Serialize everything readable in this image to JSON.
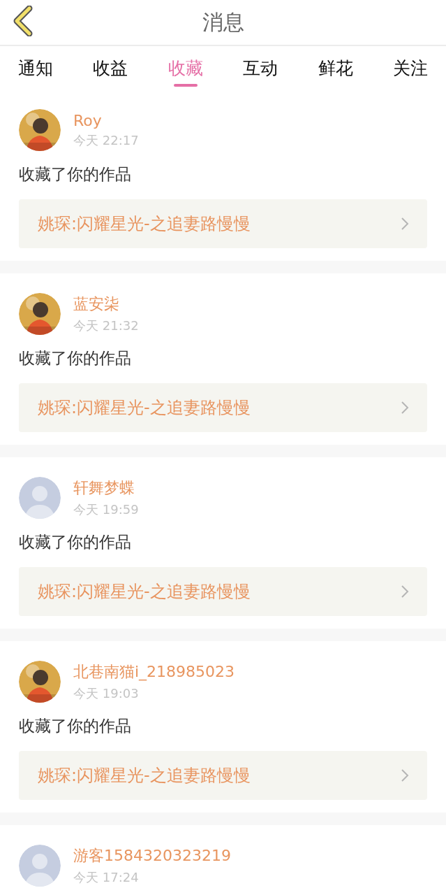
{
  "header": {
    "title": "消息"
  },
  "tabs": [
    {
      "label": "通知",
      "selected": false
    },
    {
      "label": "收益",
      "selected": false
    },
    {
      "label": "收藏",
      "selected": true
    },
    {
      "label": "互动",
      "selected": false
    },
    {
      "label": "鲜花",
      "selected": false
    },
    {
      "label": "关注",
      "selected": false
    }
  ],
  "messages": [
    {
      "name": "Roy",
      "time": "今天 22:17",
      "action": "收藏了你的作品",
      "work": "姚琛:闪耀星光-之追妻路慢慢"
    },
    {
      "name": "蓝安柒",
      "time": "今天 21:32",
      "action": "收藏了你的作品",
      "work": "姚琛:闪耀星光-之追妻路慢慢"
    },
    {
      "avatar": {
        "kind": "default"
      },
      "name": "轩舞梦蝶",
      "time": "今天 19:59",
      "action": "收藏了你的作品",
      "work": "姚琛:闪耀星光-之追妻路慢慢"
    },
    {
      "name": "北巷南猫i_218985023",
      "time": "今天 19:03",
      "action": "收藏了你的作品",
      "work": "姚琛:闪耀星光-之追妻路慢慢"
    },
    {
      "avatar": {
        "kind": "default"
      },
      "name": "游客1584320323219",
      "time": "今天 17:24"
    }
  ]
}
